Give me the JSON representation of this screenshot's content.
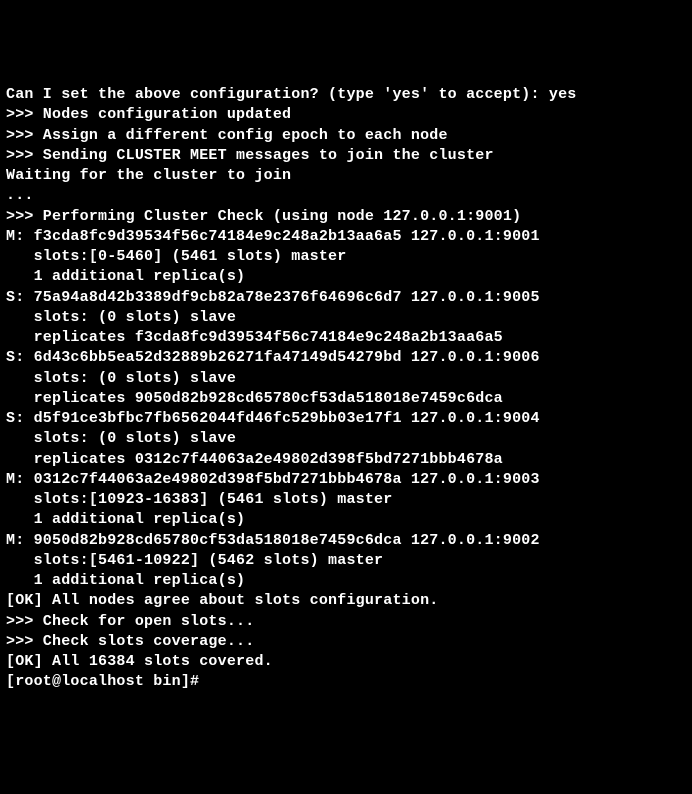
{
  "lines": [
    "Can I set the above configuration? (type 'yes' to accept): yes",
    ">>> Nodes configuration updated",
    ">>> Assign a different config epoch to each node",
    ">>> Sending CLUSTER MEET messages to join the cluster",
    "Waiting for the cluster to join",
    "...",
    ">>> Performing Cluster Check (using node 127.0.0.1:9001)",
    "M: f3cda8fc9d39534f56c74184e9c248a2b13aa6a5 127.0.0.1:9001",
    "   slots:[0-5460] (5461 slots) master",
    "   1 additional replica(s)",
    "S: 75a94a8d42b3389df9cb82a78e2376f64696c6d7 127.0.0.1:9005",
    "   slots: (0 slots) slave",
    "   replicates f3cda8fc9d39534f56c74184e9c248a2b13aa6a5",
    "S: 6d43c6bb5ea52d32889b26271fa47149d54279bd 127.0.0.1:9006",
    "   slots: (0 slots) slave",
    "   replicates 9050d82b928cd65780cf53da518018e7459c6dca",
    "S: d5f91ce3bfbc7fb6562044fd46fc529bb03e17f1 127.0.0.1:9004",
    "   slots: (0 slots) slave",
    "   replicates 0312c7f44063a2e49802d398f5bd7271bbb4678a",
    "M: 0312c7f44063a2e49802d398f5bd7271bbb4678a 127.0.0.1:9003",
    "   slots:[10923-16383] (5461 slots) master",
    "   1 additional replica(s)",
    "M: 9050d82b928cd65780cf53da518018e7459c6dca 127.0.0.1:9002",
    "   slots:[5461-10922] (5462 slots) master",
    "   1 additional replica(s)",
    "[OK] All nodes agree about slots configuration.",
    ">>> Check for open slots...",
    ">>> Check slots coverage...",
    "[OK] All 16384 slots covered.",
    "[root@localhost bin]#"
  ]
}
